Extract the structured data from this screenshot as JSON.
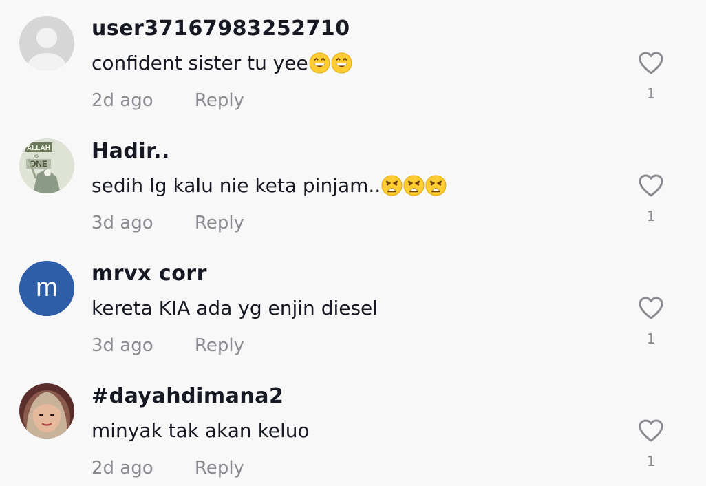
{
  "comments": [
    {
      "username": "user37167983252710",
      "text": "confident sister tu yee",
      "emojis": [
        "grin-emoji",
        "grin-emoji"
      ],
      "time": "2d ago",
      "reply_label": "Reply",
      "likes": "1",
      "avatar": "default-avatar"
    },
    {
      "username": "Hadir..",
      "text": "sedih lg kalu nie keta pinjam..",
      "emojis": [
        "weary-emoji",
        "weary-emoji",
        "weary-emoji"
      ],
      "time": "3d ago",
      "reply_label": "Reply",
      "likes": "1",
      "avatar": "image-avatar",
      "avatar_text": [
        "ALLAH",
        "IS",
        "ONE"
      ]
    },
    {
      "username": "mrvx corr",
      "text": "kereta KIA ada yg enjin diesel",
      "emojis": [],
      "time": "3d ago",
      "reply_label": "Reply",
      "likes": "1",
      "avatar": "letter-avatar",
      "avatar_letter": "m",
      "avatar_color": "#2f5ea8"
    },
    {
      "username": "#dayahdimana2",
      "text": "minyak tak akan keluo",
      "emojis": [],
      "time": "2d ago",
      "reply_label": "Reply",
      "likes": "1",
      "avatar": "photo-avatar"
    }
  ],
  "colors": {
    "background": "#f8f8f8",
    "username": "#161823",
    "muted": "#8a8b91",
    "heart_stroke": "#8a8b91"
  }
}
